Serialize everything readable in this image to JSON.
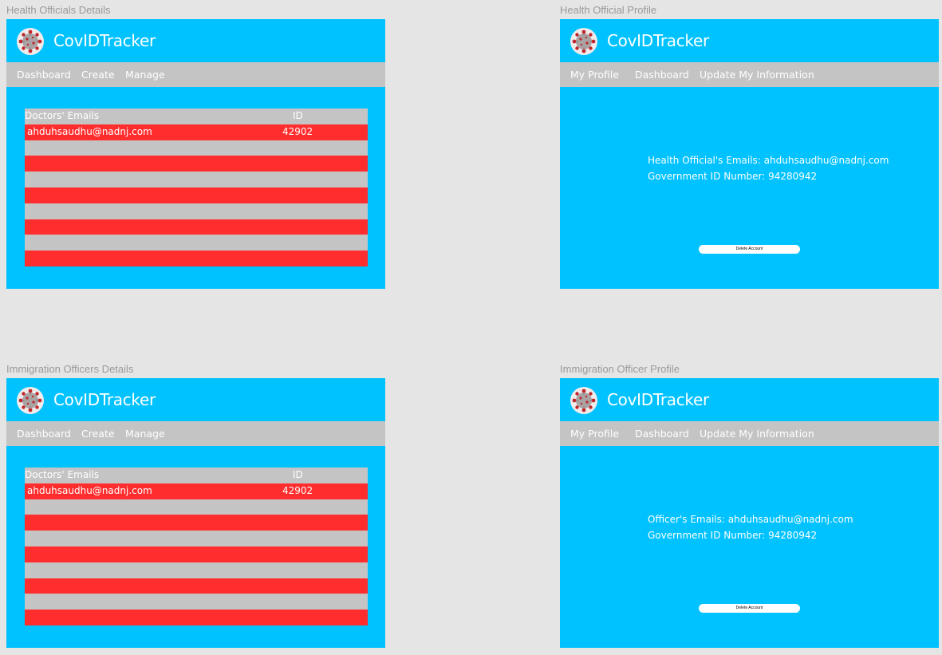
{
  "brand": {
    "name": "CovIDTracker",
    "logo_icon": "virus-icon"
  },
  "colors": {
    "canvas": "#e5e5e5",
    "frame": "#00c2ff",
    "nav": "#c4c4c4",
    "row_red": "#ff2d2d",
    "row_gray": "#c4c4c4"
  },
  "health_officials_details": {
    "frame_title": "Health Officials Details",
    "nav": [
      "Dashboard",
      "Create",
      "Manage"
    ],
    "table": {
      "headers": {
        "email": "Doctors' Emails",
        "id": "ID"
      },
      "rows": [
        {
          "email": "ahduhsaudhu@nadnj.com",
          "id": "42902"
        },
        {
          "email": "",
          "id": ""
        },
        {
          "email": "",
          "id": ""
        },
        {
          "email": "",
          "id": ""
        },
        {
          "email": "",
          "id": ""
        },
        {
          "email": "",
          "id": ""
        },
        {
          "email": "",
          "id": ""
        },
        {
          "email": "",
          "id": ""
        },
        {
          "email": "",
          "id": ""
        }
      ]
    }
  },
  "health_official_profile": {
    "frame_title": "Health Official Profile",
    "nav": [
      "My Profile",
      "Dashboard",
      "Update My Information"
    ],
    "email_label": "Health Official's Emails:",
    "email_value": "ahduhsaudhu@nadnj.com",
    "gov_id_label": "Government ID Number:",
    "gov_id_value": "94280942",
    "delete_label": "Delete Account"
  },
  "immigration_officers_details": {
    "frame_title": "Immigration Officers Details",
    "nav": [
      "Dashboard",
      "Create",
      "Manage"
    ],
    "table": {
      "headers": {
        "email": "Doctors' Emails",
        "id": "ID"
      },
      "rows": [
        {
          "email": "ahduhsaudhu@nadnj.com",
          "id": "42902"
        },
        {
          "email": "",
          "id": ""
        },
        {
          "email": "",
          "id": ""
        },
        {
          "email": "",
          "id": ""
        },
        {
          "email": "",
          "id": ""
        },
        {
          "email": "",
          "id": ""
        },
        {
          "email": "",
          "id": ""
        },
        {
          "email": "",
          "id": ""
        },
        {
          "email": "",
          "id": ""
        }
      ]
    }
  },
  "immigration_officer_profile": {
    "frame_title": "Immigration Officer Profile",
    "nav": [
      "My Profile",
      "Dashboard",
      "Update My Information"
    ],
    "email_label": "Officer's Emails:",
    "email_value": "ahduhsaudhu@nadnj.com",
    "gov_id_label": "Government ID Number:",
    "gov_id_value": "94280942",
    "delete_label": "Delete Account"
  }
}
